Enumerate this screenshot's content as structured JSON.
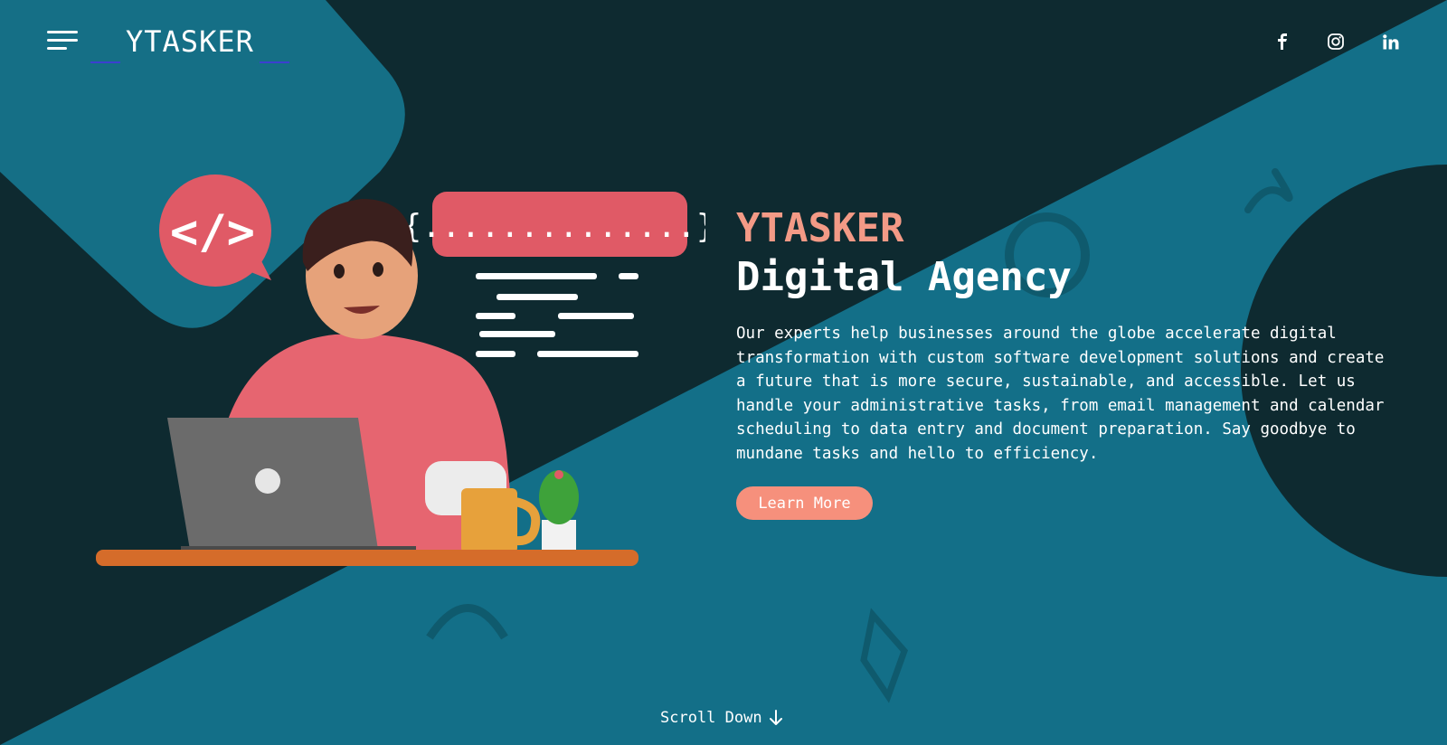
{
  "header": {
    "logo_text": "YTASKER",
    "menu_icon": "hamburger-icon",
    "social": [
      {
        "name": "facebook",
        "icon": "facebook-icon",
        "glyph": "f"
      },
      {
        "name": "instagram",
        "icon": "instagram-icon"
      },
      {
        "name": "linkedin",
        "icon": "linkedin-icon",
        "glyph": "in"
      }
    ]
  },
  "hero": {
    "brand": "YTASKER",
    "headline": "Digital Agency",
    "description": "Our experts help businesses around the globe accelerate digital transformation with custom software development solutions and create a future that is more secure, sustainable, and accessible. Let us handle your administrative tasks, from email management and calendar scheduling to data entry and document preparation. Say goodbye to mundane tasks and hello to efficiency.",
    "cta_label": "Learn More"
  },
  "footer": {
    "scroll_label": "Scroll Down",
    "scroll_icon": "arrow-down-icon"
  },
  "illustration": {
    "code_tag": "</>",
    "code_braces": "{..............}"
  },
  "colors": {
    "background_dark": "#0e2a30",
    "background_teal": "#136f88",
    "accent": "#f39a86",
    "button": "#f6907c",
    "logo_underline": "#3c3fd0"
  }
}
